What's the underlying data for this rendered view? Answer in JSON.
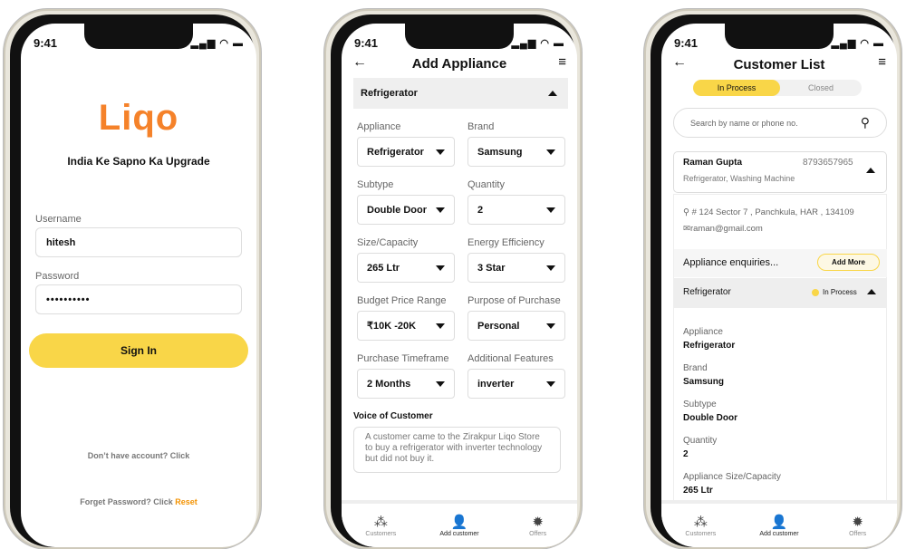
{
  "status": {
    "time": "9:41",
    "signal": "▂▄▆",
    "wifi": "◠",
    "battery": "▬"
  },
  "login": {
    "logo": "Liqo",
    "tagline": "India Ke Sapno Ka Upgrade",
    "username_label": "Username",
    "username_value": "hitesh",
    "password_label": "Password",
    "password_value": "••••••••••",
    "signin": "Sign In",
    "no_account": "Don’t have account? Click",
    "forget": "Forget Password? Click",
    "reset": "Reset"
  },
  "add": {
    "title": "Add Appliance",
    "section": "Refrigerator",
    "fields": [
      {
        "label": "Appliance",
        "value": "Refrigerator"
      },
      {
        "label": "Brand",
        "value": "Samsung"
      },
      {
        "label": "Subtype",
        "value": "Double Door"
      },
      {
        "label": "Quantity",
        "value": "2"
      },
      {
        "label": "Size/Capacity",
        "value": "265 Ltr"
      },
      {
        "label": "Energy Efficiency",
        "value": "3 Star"
      },
      {
        "label": "Budget Price Range",
        "value": "₹10K -20K"
      },
      {
        "label": "Purpose of Purchase",
        "value": "Personal"
      },
      {
        "label": "Purchase Timeframe",
        "value": "2 Months"
      },
      {
        "label": "Additional Features",
        "value": "inverter"
      }
    ],
    "voice_label": "Voice of Customer",
    "voice_text": "A customer came to the Zirakpur Liqo Store to buy a refrigerator with inverter technology but did not buy it."
  },
  "list": {
    "title": "Customer  List",
    "tabs": [
      "In Process",
      "Closed"
    ],
    "search_placeholder": "Search by name or phone no.",
    "customer": {
      "name": "Raman Gupta",
      "phone": "8793657965",
      "appliances": "Refrigerator, Washing Machine",
      "address": "# 124 Sector 7 , Panchkula, HAR , 134109",
      "email": "raman@gmail.com"
    },
    "enquiries_label": "Appliance enquiries...",
    "add_more": "Add More",
    "appliance": "Refrigerator",
    "appliance_status": "In Process",
    "details": [
      {
        "label": "Appliance",
        "value": "Refrigerator"
      },
      {
        "label": "Brand",
        "value": "Samsung"
      },
      {
        "label": "Subtype",
        "value": "Double Door"
      },
      {
        "label": "Quantity",
        "value": "2"
      },
      {
        "label": "Appliance Size/Capacity",
        "value": "265 Ltr"
      }
    ]
  },
  "nav": [
    {
      "label": "Customers",
      "icon": "customers-icon"
    },
    {
      "label": "Add customer",
      "icon": "add-customer-icon"
    },
    {
      "label": "Offers",
      "icon": "offers-icon"
    }
  ],
  "colors": {
    "accent": "#F9D648",
    "brand_orange": "#F5822A",
    "reset": "#F39200"
  }
}
